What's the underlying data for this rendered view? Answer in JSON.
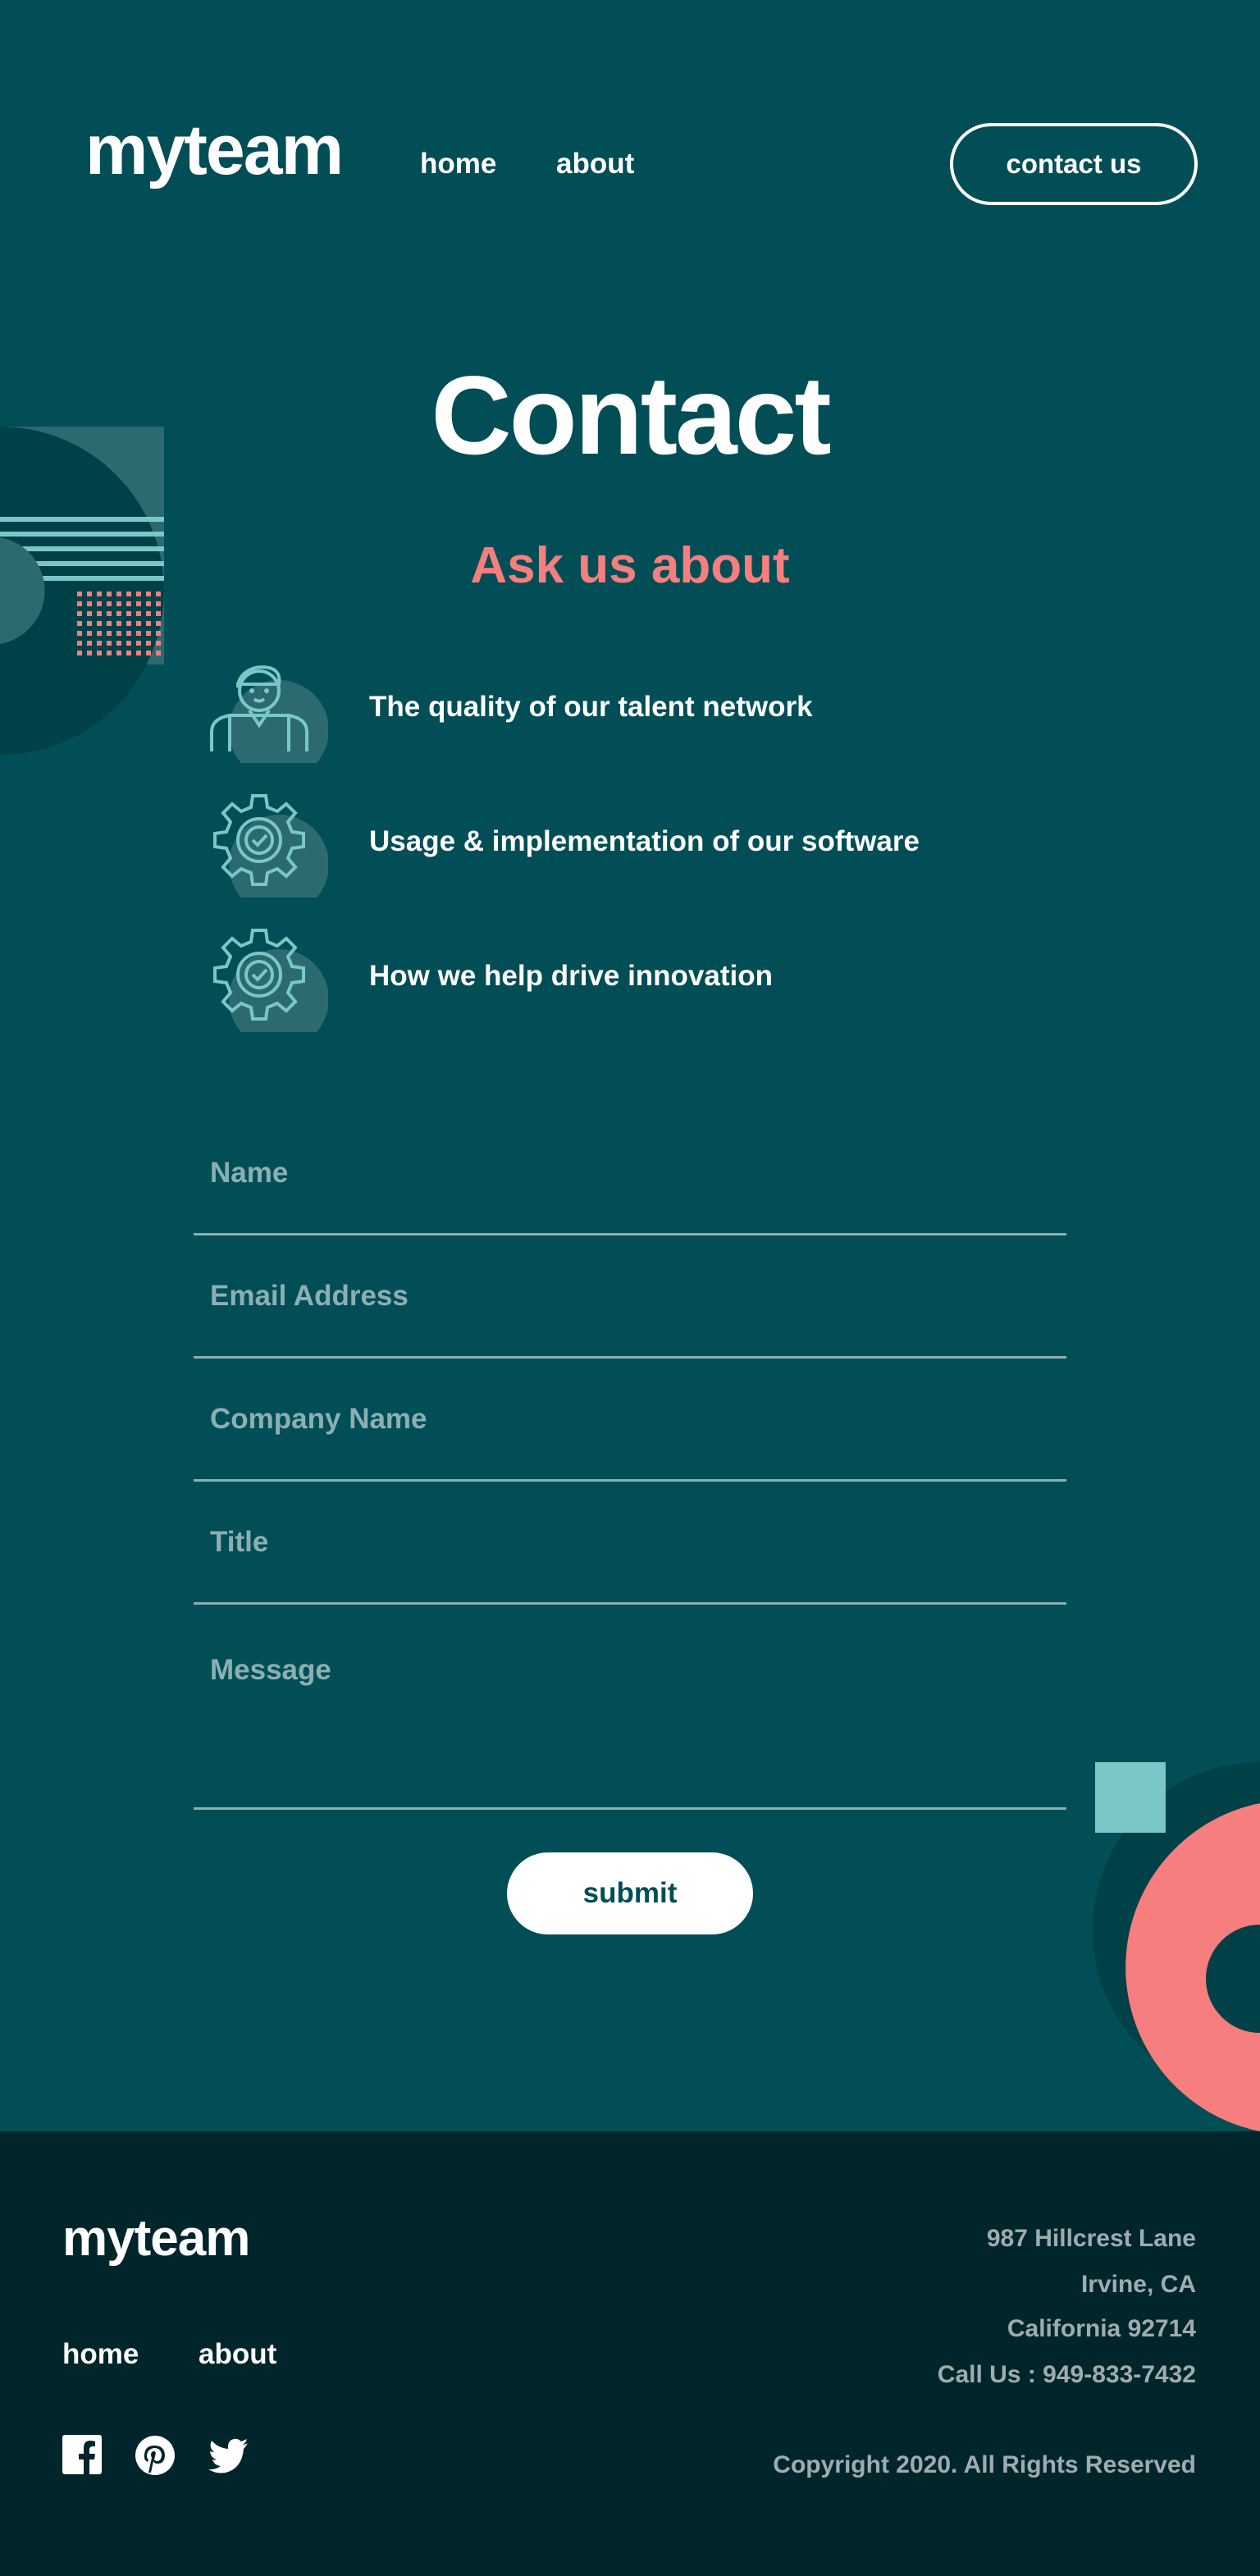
{
  "header": {
    "logo": "myteam",
    "nav": [
      "home",
      "about"
    ],
    "cta": "contact us"
  },
  "hero": {
    "title": "Contact",
    "subtitle": "Ask us about"
  },
  "features": [
    {
      "icon": "person-icon",
      "label": "The quality of our talent network"
    },
    {
      "icon": "gear-check-icon",
      "label": "Usage & implementation of our software"
    },
    {
      "icon": "gear-check-icon",
      "label": "How we help drive innovation"
    }
  ],
  "form": {
    "name_placeholder": "Name",
    "email_placeholder": "Email Address",
    "company_placeholder": "Company Name",
    "title_placeholder": "Title",
    "message_placeholder": "Message",
    "submit_label": "submit"
  },
  "footer": {
    "logo": "myteam",
    "nav": [
      "home",
      "about"
    ],
    "social": [
      "facebook-icon",
      "pinterest-icon",
      "twitter-icon"
    ],
    "address": [
      "987 Hillcrest Lane",
      "Irvine, CA",
      "California 92714",
      "Call Us : 949-833-7432"
    ],
    "copyright": "Copyright 2020. All Rights Reserved"
  },
  "colors": {
    "primary_bg": "#014E56",
    "footer_bg": "#00252B",
    "accent_coral": "#F67E7E",
    "accent_teal": "#79C8C7",
    "dark_teal": "#004047"
  }
}
